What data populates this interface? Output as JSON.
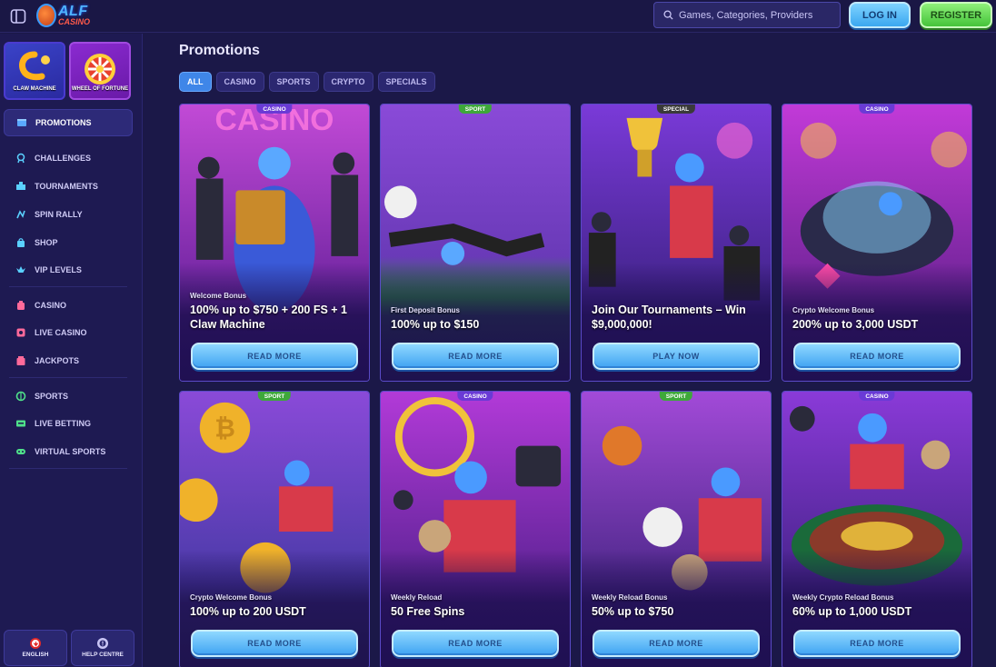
{
  "header": {
    "logo_main": "ALF",
    "logo_sub": "CASINO",
    "search_placeholder": "Games, Categories, Providers",
    "login_label": "LOG IN",
    "register_label": "REGISTER"
  },
  "sidebar": {
    "quick_tiles": [
      {
        "label": "CLAW MACHINE"
      },
      {
        "label": "WHEEL OF FORTUNE"
      }
    ],
    "items": [
      {
        "label": "PROMOTIONS",
        "icon": "promotions-icon"
      },
      {
        "label": "CHALLENGES",
        "icon": "challenges-icon"
      },
      {
        "label": "TOURNAMENTS",
        "icon": "tournaments-icon"
      },
      {
        "label": "SPIN RALLY",
        "icon": "spin-rally-icon"
      },
      {
        "label": "SHOP",
        "icon": "shop-icon"
      },
      {
        "label": "VIP LEVELS",
        "icon": "vip-icon"
      },
      {
        "label": "CASINO",
        "icon": "casino-icon"
      },
      {
        "label": "LIVE CASINO",
        "icon": "live-casino-icon"
      },
      {
        "label": "JACKPOTS",
        "icon": "jackpots-icon"
      },
      {
        "label": "SPORTS",
        "icon": "sports-icon"
      },
      {
        "label": "LIVE BETTING",
        "icon": "live-betting-icon"
      },
      {
        "label": "VIRTUAL SPORTS",
        "icon": "virtual-sports-icon"
      }
    ],
    "bottom": {
      "language_label": "ENGLISH",
      "help_label": "HELP CENTRE"
    }
  },
  "main": {
    "title": "Promotions",
    "filters": [
      "ALL",
      "CASINO",
      "SPORTS",
      "CRYPTO",
      "SPECIALS"
    ],
    "active_filter": "ALL",
    "cards": [
      {
        "tag": "CASINO",
        "subtitle": "Welcome Bonus",
        "title": "100% up to $750 + 200 FS + 1 Claw Machine",
        "button": "READ MORE"
      },
      {
        "tag": "SPORT",
        "subtitle": "First Deposit Bonus",
        "title": "100% up to $150",
        "button": "READ MORE"
      },
      {
        "tag": "SPECIAL",
        "subtitle": "",
        "title": "Join Our Tournaments – Win $9,000,000!",
        "button": "PLAY NOW"
      },
      {
        "tag": "CASINO",
        "subtitle": "Crypto Welcome Bonus",
        "title": "200% up to 3,000 USDT",
        "button": "READ MORE"
      },
      {
        "tag": "SPORT",
        "subtitle": "Crypto Welcome Bonus",
        "title": "100% up to 200 USDT",
        "button": "READ MORE"
      },
      {
        "tag": "CASINO",
        "subtitle": "Weekly Reload",
        "title": "50 Free Spins",
        "button": "READ MORE"
      },
      {
        "tag": "SPORT",
        "subtitle": "Weekly Reload Bonus",
        "title": "50% up to $750",
        "button": "READ MORE"
      },
      {
        "tag": "CASINO",
        "subtitle": "Weekly Crypto Reload Bonus",
        "title": "60% up to 1,000 USDT",
        "button": "READ MORE"
      }
    ]
  },
  "colors": {
    "background": "#1b1848",
    "sidebar": "#1e1a52",
    "accent_blue": "#3f86e8",
    "register_green": "#45c43a"
  }
}
